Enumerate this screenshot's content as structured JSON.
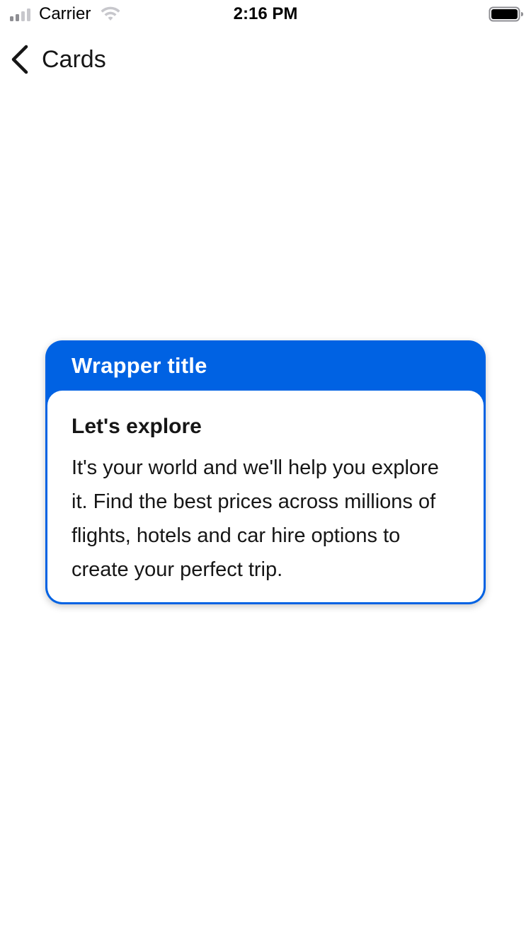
{
  "status_bar": {
    "carrier": "Carrier",
    "time": "2:16 PM",
    "signal_icon": "cellular-signal-icon",
    "wifi_icon": "wifi-icon",
    "battery_icon": "battery-icon"
  },
  "nav": {
    "back_icon": "chevron-left-icon",
    "title": "Cards"
  },
  "card": {
    "wrapper_title": "Wrapper title",
    "heading": "Let's explore",
    "body": "It's your world and we'll help you explore it. Find the best prices across millions of flights, hotels and car hire options to create your perfect trip."
  },
  "colors": {
    "accent": "#0062e3",
    "text": "#161616",
    "background": "#ffffff",
    "inactive_signal": "#c7c7cc"
  }
}
